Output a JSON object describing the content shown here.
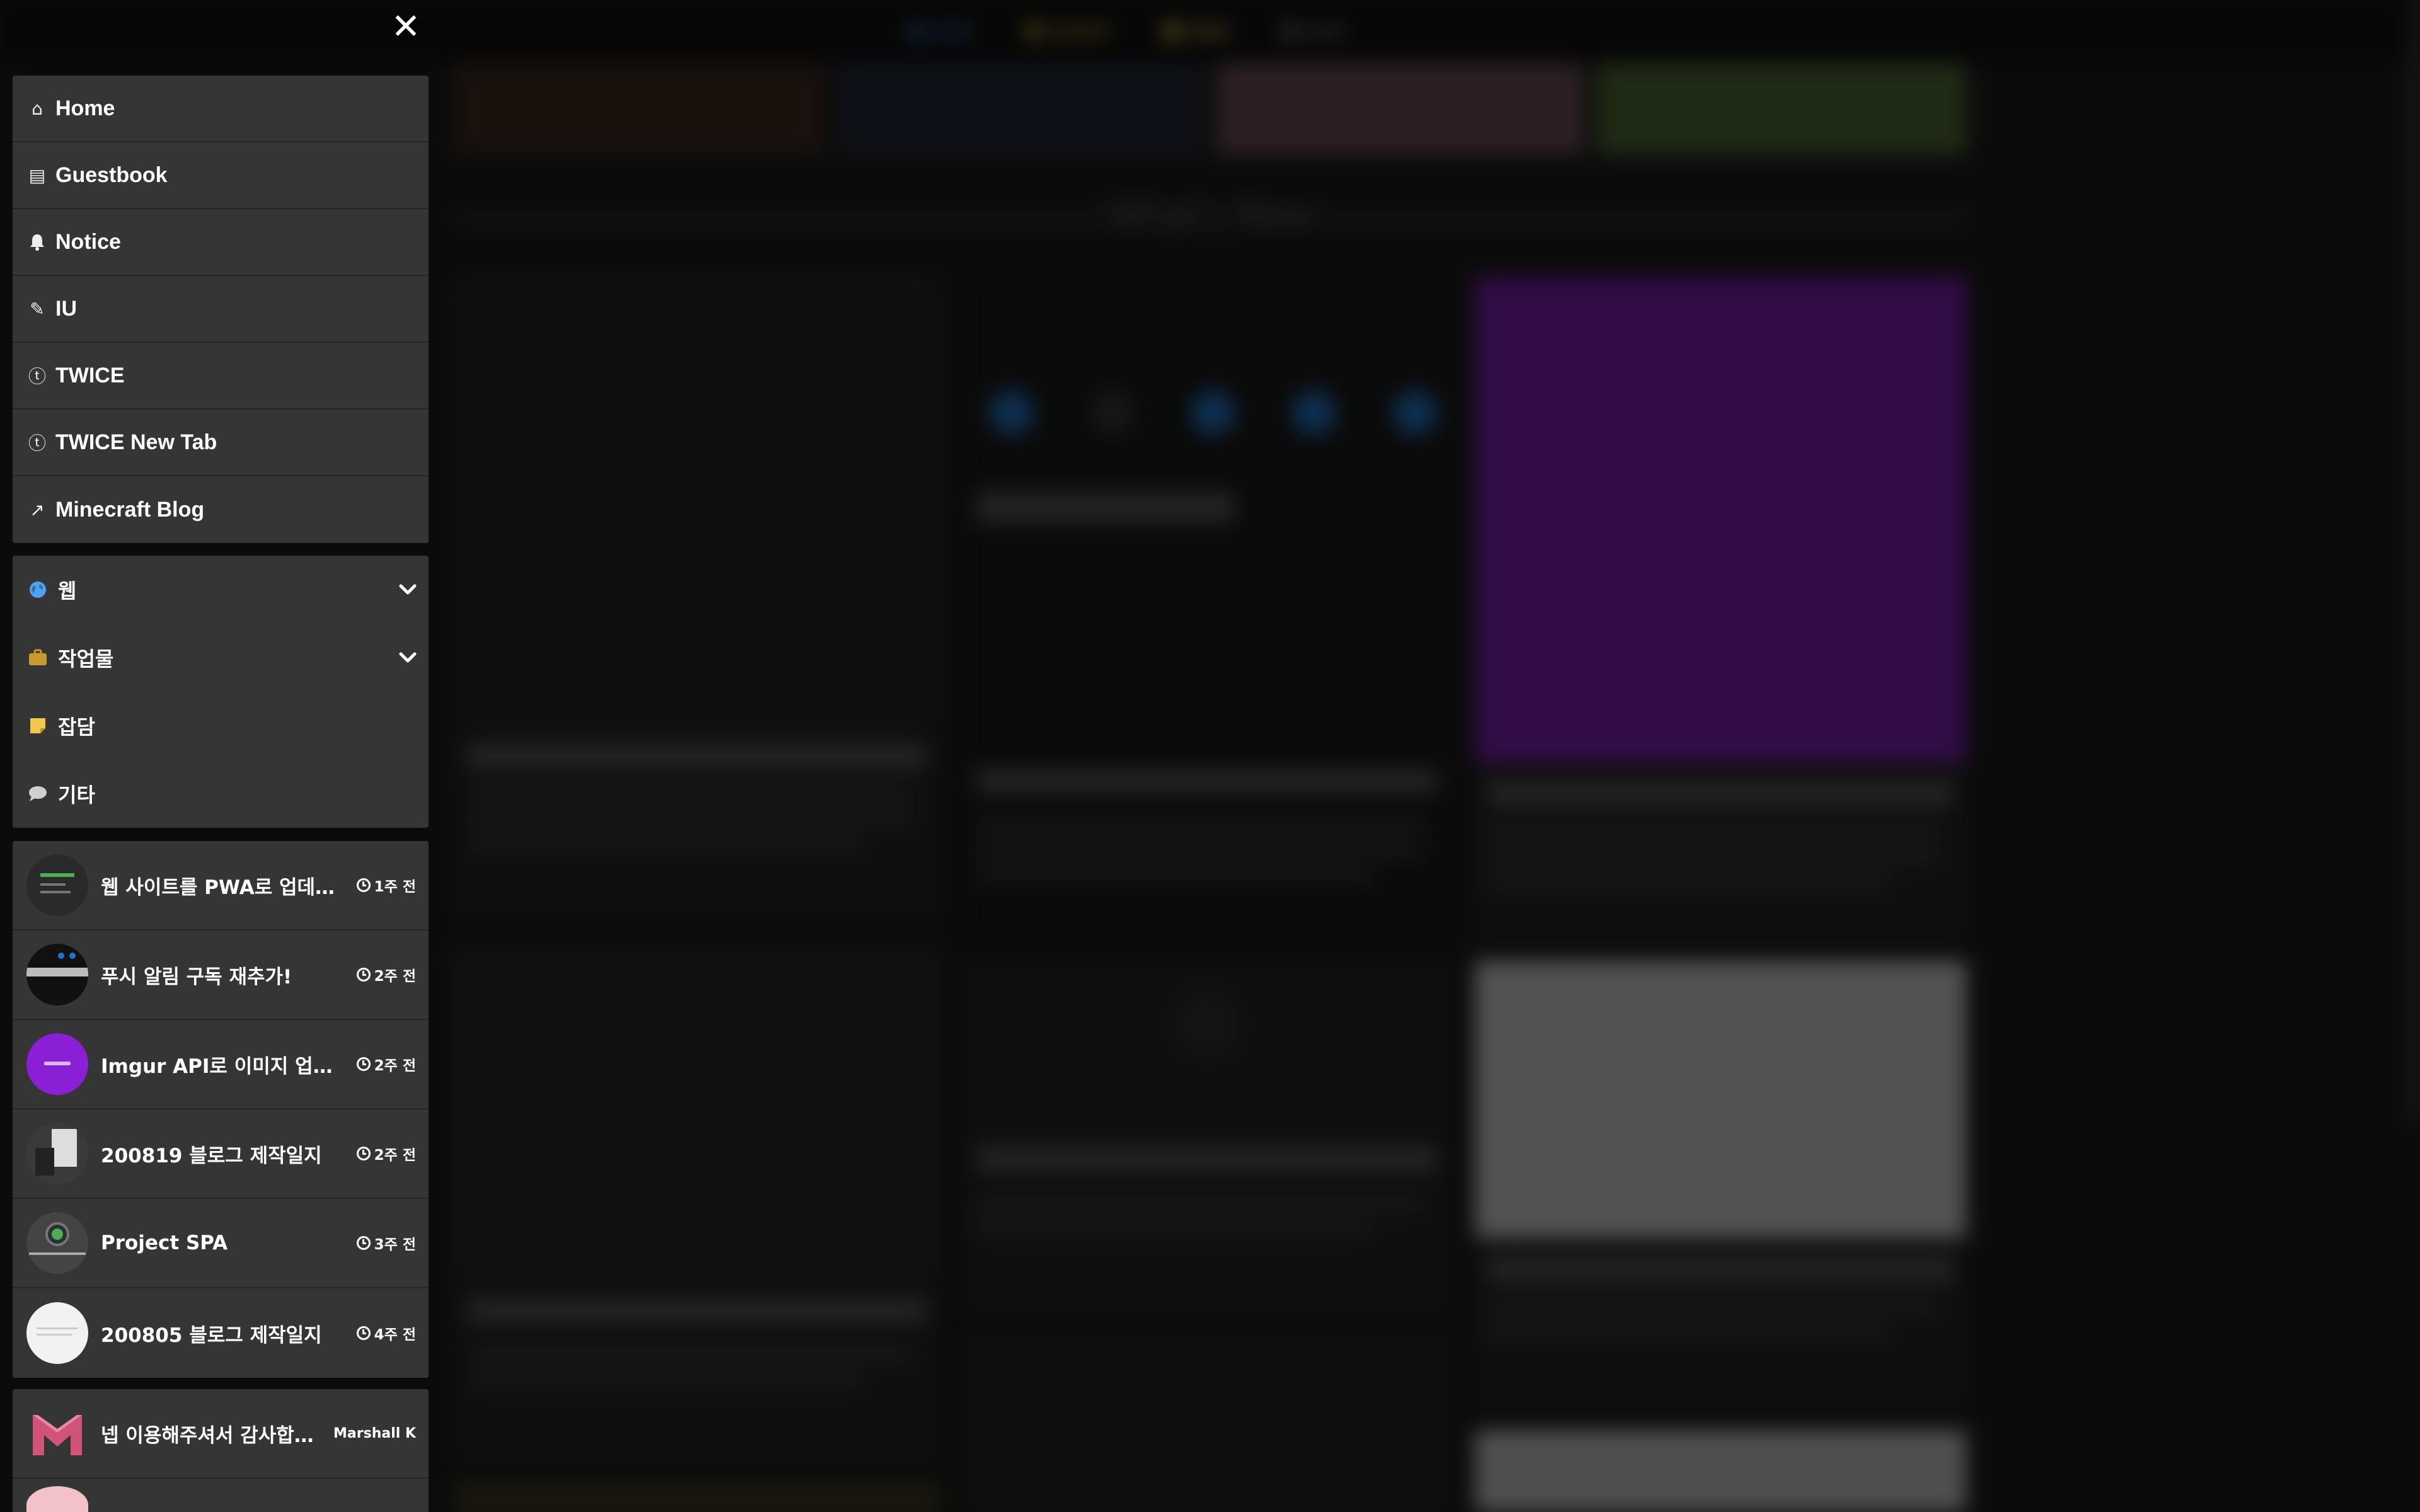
{
  "close_label": "✕",
  "nav_menu": [
    {
      "label": "Home",
      "icon": "home-icon",
      "glyph": "⌂"
    },
    {
      "label": "Guestbook",
      "icon": "book-icon",
      "glyph": "▤"
    },
    {
      "label": "Notice",
      "icon": "bell-icon",
      "glyph": "🔔"
    },
    {
      "label": "IU",
      "icon": "feather-icon",
      "glyph": "✎"
    },
    {
      "label": "TWICE",
      "icon": "twice-logo-icon",
      "glyph": "ⓣ"
    },
    {
      "label": "TWICE New Tab",
      "icon": "twice-logo-icon",
      "glyph": "ⓣ"
    },
    {
      "label": "Minecraft Blog",
      "icon": "external-link-icon",
      "glyph": "↗"
    }
  ],
  "categories": [
    {
      "label": "웹",
      "icon": "globe-icon",
      "color": "#4ea3ef",
      "expandable": true
    },
    {
      "label": "작업물",
      "icon": "briefcase-icon",
      "color": "#c99a2e",
      "expandable": true
    },
    {
      "label": "잡담",
      "icon": "sticky-note-icon",
      "color": "#f2c94c",
      "expandable": false
    },
    {
      "label": "기타",
      "icon": "comment-icon",
      "color": "#cfcfcf",
      "expandable": false
    }
  ],
  "recent_posts": [
    {
      "title": "웹 사이트를 PWA로 업데…",
      "time": "1주 전",
      "avatar_color": "#2a2a2a"
    },
    {
      "title": "푸시 알림 구독 재추가!",
      "time": "2주 전",
      "avatar_color": "#111111"
    },
    {
      "title": "Imgur API로 이미지 업로…",
      "time": "2주 전",
      "avatar_color": "#8a1fd6"
    },
    {
      "title": "200819 블로그 제작일지",
      "time": "2주 전",
      "avatar_color": "#3a3a3a"
    },
    {
      "title": "Project SPA",
      "time": "3주 전",
      "avatar_color": "#444444"
    },
    {
      "title": "200805 블로그 제작일지",
      "time": "4주 전",
      "avatar_color": "#f2f2f2"
    }
  ],
  "recent_comments": [
    {
      "text": "넵 이용해주셔서 감사합…",
      "author": "Marshall K"
    }
  ],
  "background": {
    "heading": "What's New"
  },
  "colors": {
    "panel": "#353535",
    "imgur_purple": "#7a16b8",
    "marshall_pink": "#d0537a"
  }
}
